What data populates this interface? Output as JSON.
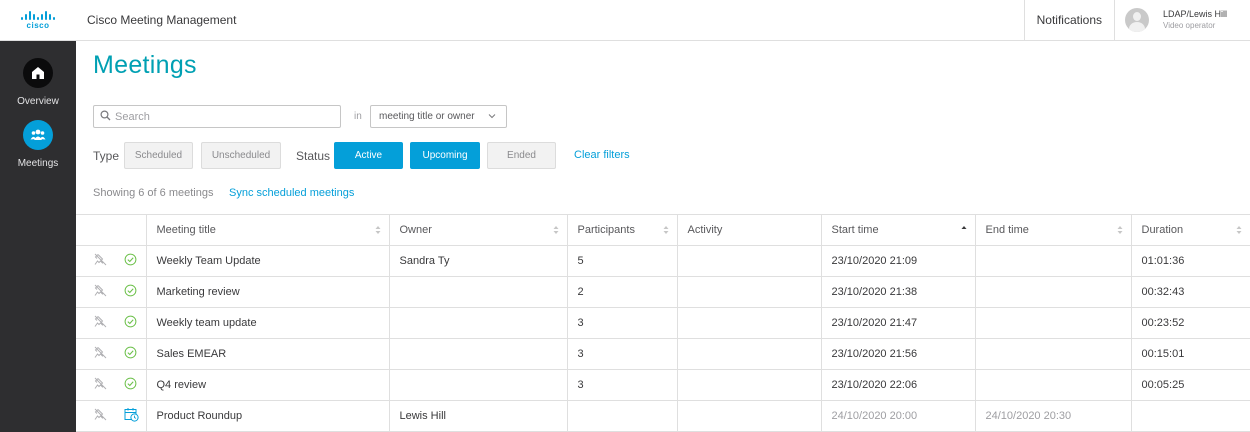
{
  "header": {
    "logo_text": "cisco",
    "app_title": "Cisco Meeting Management",
    "notifications_label": "Notifications",
    "user_name": "LDAP/Lewis Hill",
    "user_role": "Video operator"
  },
  "sidebar": {
    "items": [
      {
        "label": "Overview",
        "icon": "home-icon",
        "active": false
      },
      {
        "label": "Meetings",
        "icon": "people-icon",
        "active": true
      }
    ]
  },
  "page": {
    "title": "Meetings"
  },
  "search": {
    "placeholder": "Search",
    "value": "",
    "in_label": "in",
    "field_selected": "meeting title or owner"
  },
  "filters": {
    "type_label": "Type",
    "type_options": [
      {
        "label": "Scheduled",
        "active": false
      },
      {
        "label": "Unscheduled",
        "active": false
      }
    ],
    "status_label": "Status",
    "status_options": [
      {
        "label": "Active",
        "active": true
      },
      {
        "label": "Upcoming",
        "active": true
      },
      {
        "label": "Ended",
        "active": false
      }
    ],
    "clear_label": "Clear filters"
  },
  "summary": {
    "showing_text": "Showing 6 of 6 meetings",
    "sync_label": "Sync scheduled meetings"
  },
  "table": {
    "columns": [
      "Meeting title",
      "Owner",
      "Participants",
      "Activity",
      "Start time",
      "End time",
      "Duration"
    ],
    "sorted_column": "Start time",
    "rows": [
      {
        "status": "active",
        "title": "Weekly Team Update",
        "owner": "Sandra Ty",
        "participants": "5",
        "activity": "",
        "start": "23/10/2020 21:09",
        "end": "",
        "duration": "01:01:36"
      },
      {
        "status": "active",
        "title": "Marketing review",
        "owner": "",
        "participants": "2",
        "activity": "",
        "start": "23/10/2020 21:38",
        "end": "",
        "duration": "00:32:43"
      },
      {
        "status": "active",
        "title": "Weekly team update",
        "owner": "",
        "participants": "3",
        "activity": "",
        "start": "23/10/2020 21:47",
        "end": "",
        "duration": "00:23:52"
      },
      {
        "status": "active",
        "title": "Sales EMEAR",
        "owner": "",
        "participants": "3",
        "activity": "",
        "start": "23/10/2020 21:56",
        "end": "",
        "duration": "00:15:01"
      },
      {
        "status": "active",
        "title": "Q4 review",
        "owner": "",
        "participants": "3",
        "activity": "",
        "start": "23/10/2020 22:06",
        "end": "",
        "duration": "00:05:25"
      },
      {
        "status": "upcoming",
        "title": "Product Roundup",
        "owner": "Lewis Hill",
        "participants": "",
        "activity": "",
        "start": "24/10/2020 20:00",
        "end": "24/10/2020 20:30",
        "duration": ""
      }
    ]
  },
  "colors": {
    "accent": "#049fd9",
    "title": "#00a0b3",
    "sidebar_bg": "#2e2e30",
    "active_check": "#6cc04a"
  }
}
